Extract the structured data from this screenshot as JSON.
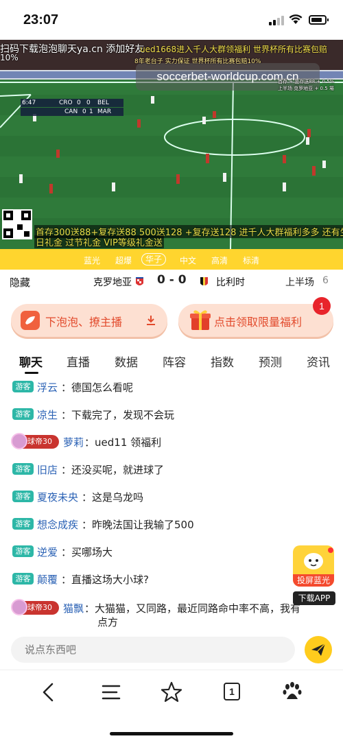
{
  "status_bar": {
    "time": "23:07"
  },
  "video": {
    "watermark": "soccerbet-worldcup.com.cn",
    "ad_top_left": "扫码下载泡泡聊天ya.cn 添加好友",
    "ad_top_pct": "10%",
    "ad_top_right": "ued1668进入千人大群领福利 世界杯所有比赛包赔",
    "ad_top_right2": "8年老台子 实力保证 世界杯所有比赛包赔10%",
    "score_overlay": {
      "clock": "6:47",
      "home": "CRO",
      "home_goals": "0",
      "away": "BEL",
      "away_goals": "0",
      "other_home": "CAN",
      "other_home_goals": "0",
      "other_away": "MAR",
      "other_away_goals": "1"
    },
    "ad_bottom_line1": "首存300送88+复存送88 500送128 +复存送128 进千人大群福利多多 还有生",
    "ad_bottom_line2": "日礼金 过节礼金 VIP等级礼金送",
    "side_note1": "首存 + 复存送88 + 0.5%",
    "side_note2": "上半场 克罗地亚 + 0.5 場",
    "colors": {
      "pitch": "#2f7a3a",
      "pitch_dark": "#286d33"
    }
  },
  "quality_bar": {
    "options": [
      "蓝光",
      "超爆",
      "华子",
      "中文",
      "高清",
      "标清"
    ],
    "active": "华子",
    "color": "#ffd52e"
  },
  "match": {
    "hide_label": "隐藏",
    "home_team": "克罗地亚",
    "score": "0 - 0",
    "away_team": "比利时",
    "half": "上半场",
    "minute": "6"
  },
  "actions": {
    "download_label": "下泡泡、撩主播",
    "download_icon": "download-arrow-icon",
    "gift_label": "点击领取限量福利",
    "gift_badge": "1"
  },
  "tabs": [
    "聊天",
    "直播",
    "数据",
    "阵容",
    "指数",
    "预测",
    "资讯"
  ],
  "active_tab": "聊天",
  "chat": [
    {
      "badge": "游客",
      "user": "浮云",
      "text": "德国怎么看呢"
    },
    {
      "badge": "游客",
      "user": "凉生",
      "text": "下载完了，发现不会玩"
    },
    {
      "badge": "球帝30",
      "user": "萝莉",
      "text": "ued11 领福利"
    },
    {
      "badge": "游客",
      "user": "旧店",
      "text": "还没买呢，就进球了"
    },
    {
      "badge": "游客",
      "user": "夏夜未央",
      "text": "这是乌龙吗"
    },
    {
      "badge": "游客",
      "user": "想念成疾",
      "text": "昨晚法国让我输了500"
    },
    {
      "badge": "游客",
      "user": "逆爱",
      "text": "买哪场大"
    },
    {
      "badge": "游客",
      "user": "颠覆",
      "text": "直播这场大小球?"
    },
    {
      "badge": "球帝30",
      "user": "猫飘",
      "text": "大猫猫，又同路，最近同路命中率不高，我有",
      "text2": "点方"
    }
  ],
  "float_app": {
    "cast_label": "投屏蓝光",
    "download_app": "下载APP"
  },
  "composer": {
    "placeholder": "说点东西吧",
    "send_icon": "send-plane-icon"
  },
  "browser_nav": {
    "back_icon": "back-arrow-icon",
    "menu_icon": "menu-lines-icon",
    "favorite_icon": "star-icon",
    "tabs_count": "1",
    "baidu_icon": "baidu-paw-icon"
  }
}
